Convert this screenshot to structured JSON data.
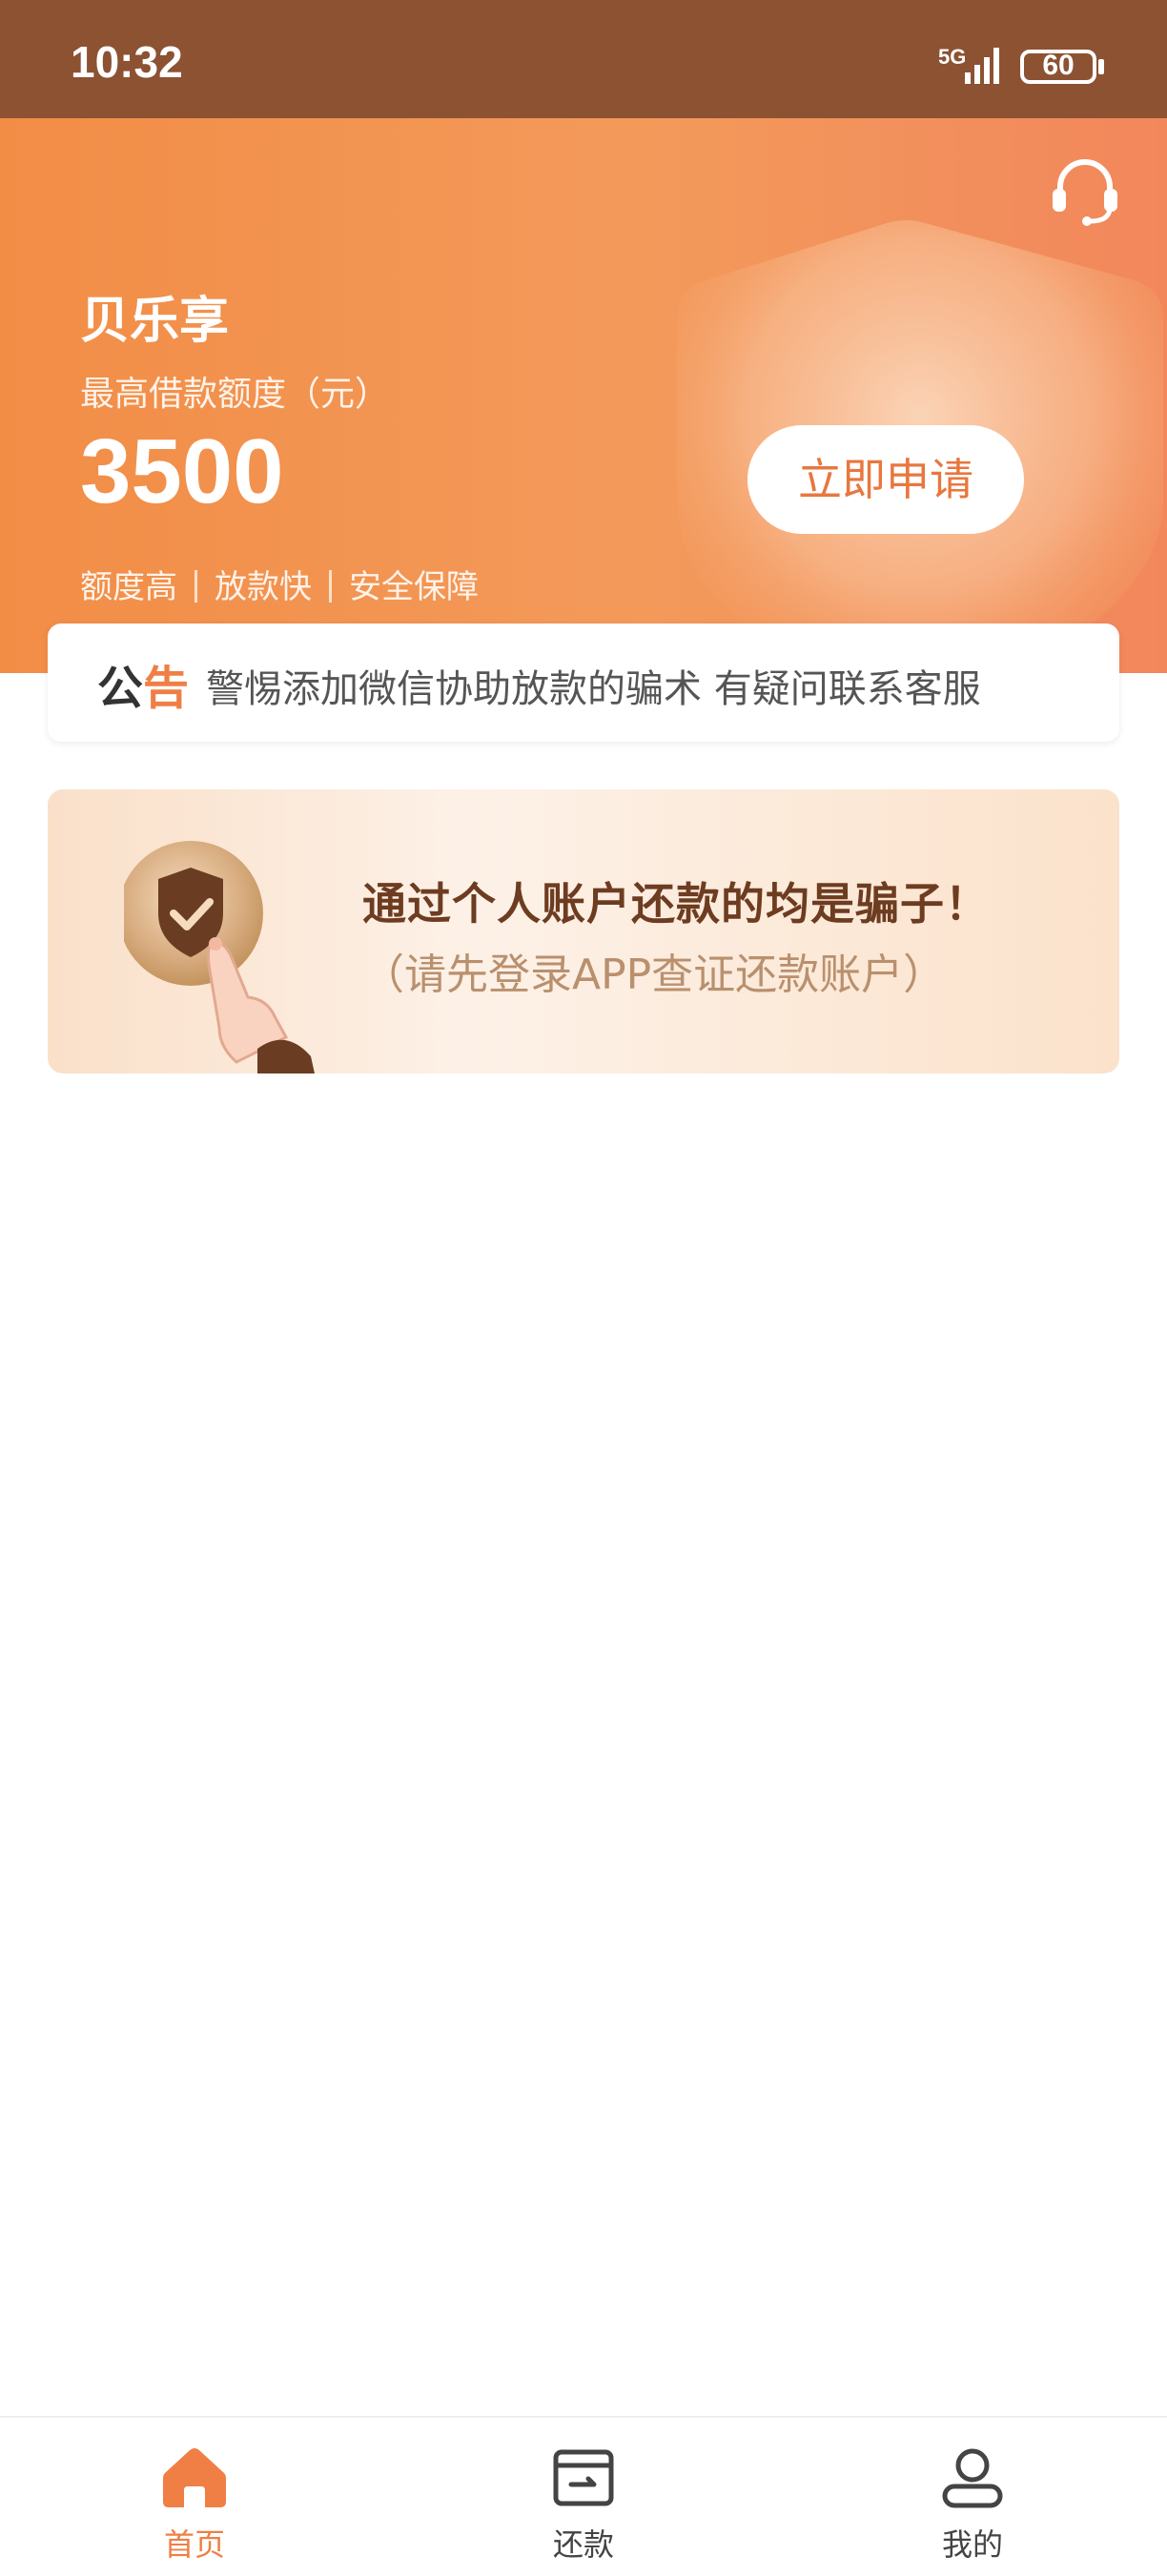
{
  "status_bar": {
    "time": "10:32",
    "network": "5G",
    "battery": "60"
  },
  "header": {
    "support_icon": "headset-icon"
  },
  "hero": {
    "brand": "贝乐享",
    "limit_label": "最高借款额度（元）",
    "limit_amount": "3500",
    "features": [
      "额度高",
      "放款快",
      "安全保障"
    ],
    "apply_button": "立即申请"
  },
  "notice": {
    "tag_part1": "公",
    "tag_part2": "告",
    "text": "警惕添加微信协助放款的骗术 有疑问联系客服"
  },
  "fraud_banner": {
    "title": "通过个人账户还款的均是骗子！",
    "subtitle": "（请先登录APP查证还款账户）"
  },
  "bottom_nav": {
    "items": [
      {
        "label": "首页",
        "icon": "home-icon",
        "active": true
      },
      {
        "label": "还款",
        "icon": "repay-card-icon",
        "active": false
      },
      {
        "label": "我的",
        "icon": "profile-icon",
        "active": false
      }
    ]
  },
  "colors": {
    "accent": "#ef7f45",
    "status_bar": "#8c5232",
    "banner_text": "#6d3c21"
  }
}
